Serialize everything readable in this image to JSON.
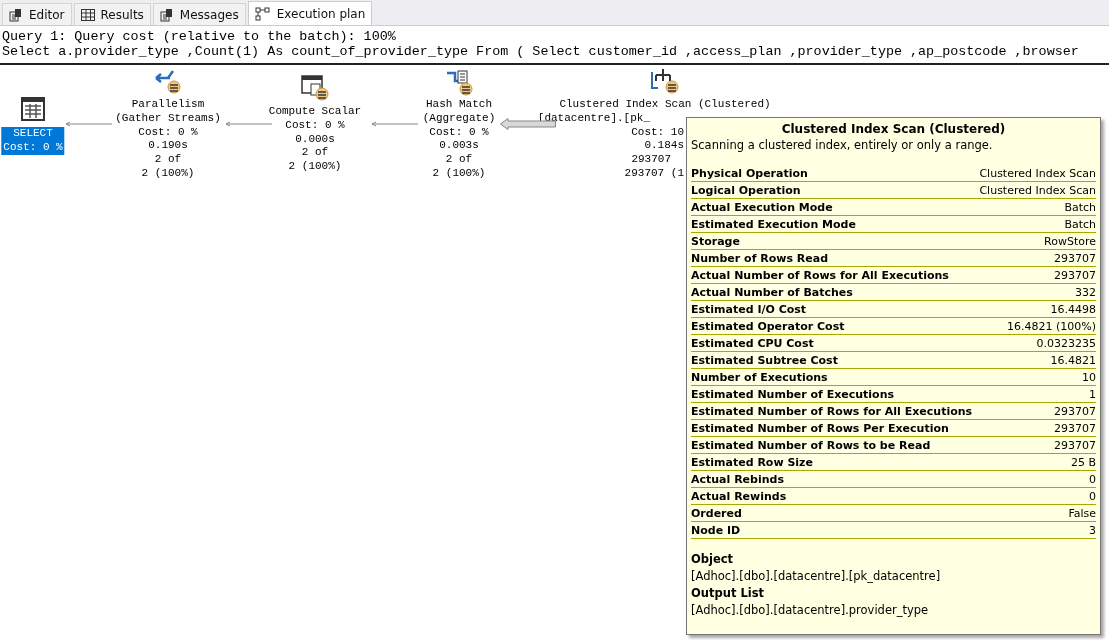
{
  "tabs": [
    {
      "label": "Editor",
      "selected": false
    },
    {
      "label": "Results",
      "selected": false
    },
    {
      "label": "Messages",
      "selected": false
    },
    {
      "label": "Execution plan",
      "selected": true
    }
  ],
  "query_header": {
    "summary": "Query 1: Query cost (relative to the batch): 100%",
    "statement": "Select a.provider_type ,Count(1) As count_of_provider_type From ( Select customer_id ,access_plan ,provider_type ,ap_postcode ,browser"
  },
  "plan": {
    "nodes": [
      {
        "kind": "select",
        "selected": true,
        "lines": [
          "SELECT",
          "Cost: 0 %"
        ]
      },
      {
        "kind": "parallelism",
        "selected": false,
        "lines": [
          "Parallelism",
          "(Gather Streams)",
          "Cost: 0 %",
          "0.190s",
          "2 of",
          "2 (100%)"
        ]
      },
      {
        "kind": "compute_scalar",
        "selected": false,
        "lines": [
          "Compute Scalar",
          "Cost: 0 %",
          "0.000s",
          "2 of",
          "2 (100%)"
        ]
      },
      {
        "kind": "hash_match",
        "selected": false,
        "lines": [
          "Hash Match",
          "(Aggregate)",
          "Cost: 0 %",
          "0.003s",
          "2 of",
          "2 (100%)"
        ]
      },
      {
        "kind": "clustered_index_scan",
        "selected": false,
        "lines": [
          "Clustered Index Scan (Clustered)",
          "[datacentre].[pk_",
          "Cost: 10",
          "0.184s",
          "293707",
          "293707 (1"
        ]
      }
    ],
    "edges": [
      {
        "kind": "thin"
      },
      {
        "kind": "thin"
      },
      {
        "kind": "thin"
      },
      {
        "kind": "thick"
      }
    ]
  },
  "tooltip": {
    "title": "Clustered Index Scan (Clustered)",
    "description": "Scanning a clustered index, entirely or only a range.",
    "properties": [
      {
        "label": "Physical Operation",
        "value": "Clustered Index Scan"
      },
      {
        "label": "Logical Operation",
        "value": "Clustered Index Scan"
      },
      {
        "label": "Actual Execution Mode",
        "value": "Batch"
      },
      {
        "label": "Estimated Execution Mode",
        "value": "Batch"
      },
      {
        "label": "Storage",
        "value": "RowStore"
      },
      {
        "label": "Number of Rows Read",
        "value": "293707"
      },
      {
        "label": "Actual Number of Rows for All Executions",
        "value": "293707"
      },
      {
        "label": "Actual Number of Batches",
        "value": "332"
      },
      {
        "label": "Estimated I/O Cost",
        "value": "16.4498"
      },
      {
        "label": "Estimated Operator Cost",
        "value": "16.4821 (100%)"
      },
      {
        "label": "Estimated CPU Cost",
        "value": "0.0323235"
      },
      {
        "label": "Estimated Subtree Cost",
        "value": "16.4821"
      },
      {
        "label": "Number of Executions",
        "value": "10"
      },
      {
        "label": "Estimated Number of Executions",
        "value": "1"
      },
      {
        "label": "Estimated Number of Rows for All Executions",
        "value": "293707"
      },
      {
        "label": "Estimated Number of Rows Per Execution",
        "value": "293707"
      },
      {
        "label": "Estimated Number of Rows to be Read",
        "value": "293707"
      },
      {
        "label": "Estimated Row Size",
        "value": "25 B"
      },
      {
        "label": "Actual Rebinds",
        "value": "0"
      },
      {
        "label": "Actual Rewinds",
        "value": "0"
      },
      {
        "label": "Ordered",
        "value": "False"
      },
      {
        "label": "Node ID",
        "value": "3"
      }
    ],
    "sections": [
      {
        "heading": "Object",
        "value": "[Adhoc].[dbo].[datacentre].[pk_datacentre]"
      },
      {
        "heading": "Output List",
        "value": "[Adhoc].[dbo].[datacentre].provider_type"
      }
    ]
  }
}
